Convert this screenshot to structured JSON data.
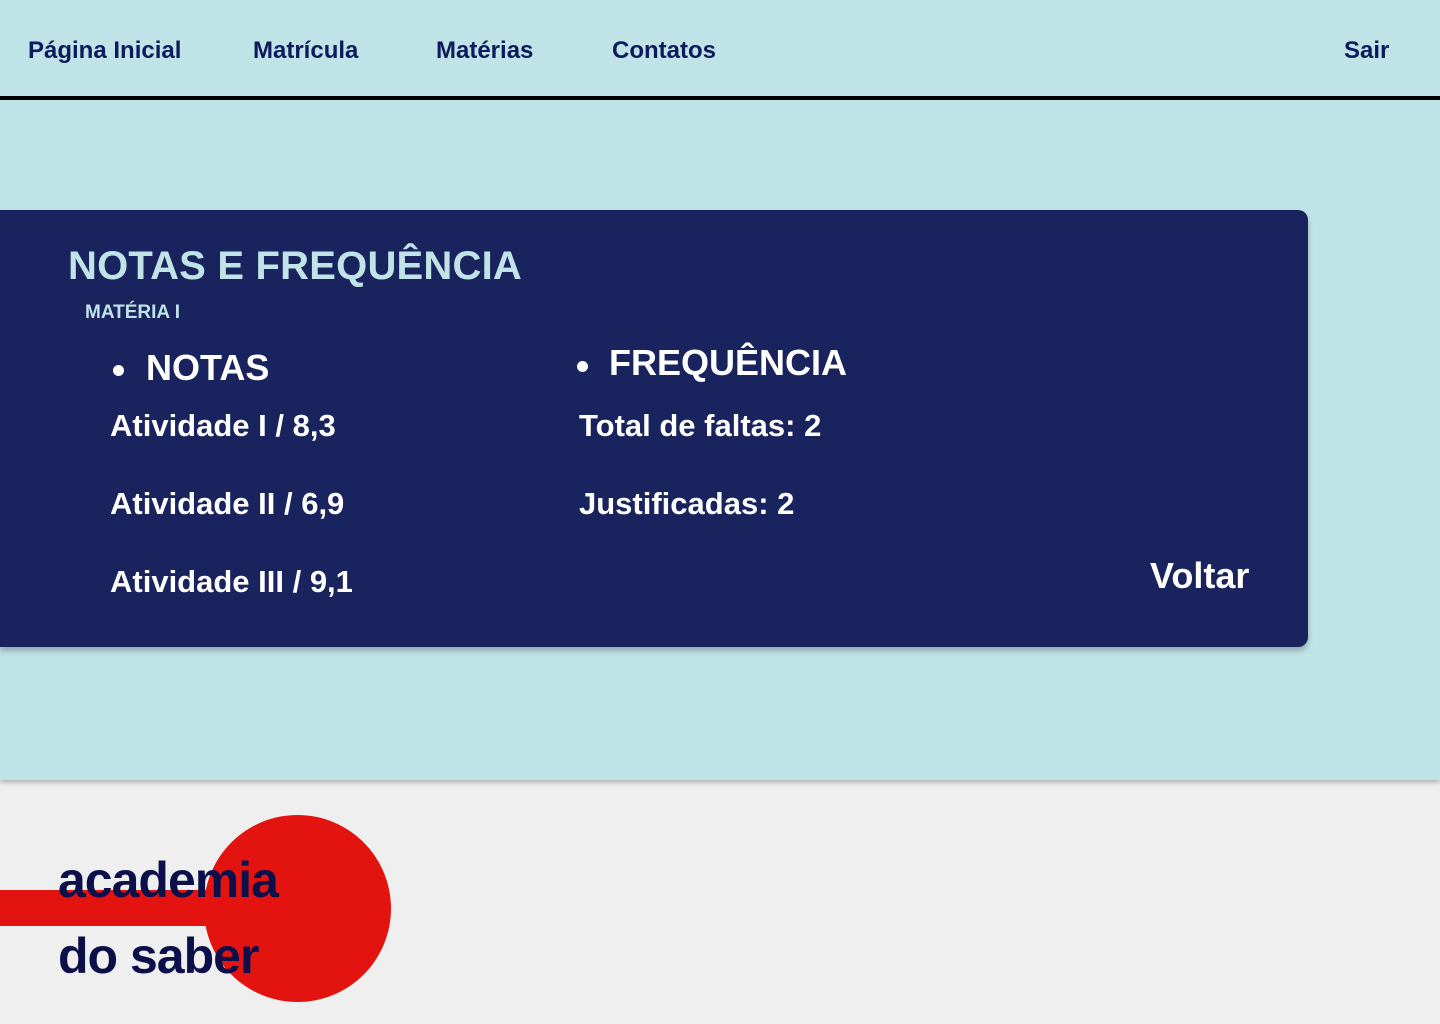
{
  "nav": {
    "home": "Página Inicial",
    "enrollment": "Matrícula",
    "subjects": "Matérias",
    "contacts": "Contatos",
    "logout": "Sair"
  },
  "card": {
    "title": "NOTAS E FREQUÊNCIA",
    "subtitle": "MATÉRIA I",
    "grades": {
      "heading": "NOTAS",
      "items": [
        "Atividade I / 8,3",
        "Atividade II / 6,9",
        "Atividade III / 9,1"
      ]
    },
    "attendance": {
      "heading": "FREQUÊNCIA",
      "items": [
        "Total de faltas: 2",
        "Justificadas: 2"
      ]
    },
    "back_label": "Voltar"
  },
  "logo": {
    "line1": "academia",
    "line2": "do saber"
  },
  "colors": {
    "background_light": "#c0e3e7",
    "card_navy": "#19235e",
    "logo_red": "#e3130f",
    "footer_gray": "#efefef"
  }
}
